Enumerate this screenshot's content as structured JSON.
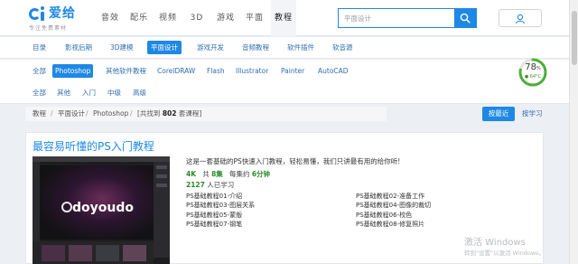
{
  "logo": {
    "text": "爱给",
    "sub": "专注免费素材"
  },
  "topnav": [
    "音效",
    "配乐",
    "视频",
    "3D",
    "游戏",
    "平面",
    "教程"
  ],
  "search": {
    "placeholder": "平面设计",
    "icon": "search-icon"
  },
  "user": {
    "icon": "user-icon"
  },
  "categories": [
    "目录",
    "影视后期",
    "3D建模",
    "平面设计",
    "游戏开发",
    "音频教程",
    "软件插件",
    "软音源"
  ],
  "software": [
    "全部",
    "Photoshop",
    "其他软件教程",
    "CorelDRAW",
    "Flash",
    "Illustrator",
    "Painter",
    "AutoCAD"
  ],
  "levels": [
    "全部",
    "其他",
    "入门",
    "中级",
    "高级"
  ],
  "gauge": {
    "percent": "78",
    "unit": "%",
    "temp": "● 64°C",
    "value": 0.78
  },
  "breadcrumb": {
    "items": [
      "教程",
      "平面设计",
      "Photoshop"
    ],
    "count_pre": "[共找到",
    "count": "802",
    "count_post": "套课程]"
  },
  "sort": {
    "latest": "按最近",
    "popular": "按学习"
  },
  "course": {
    "title": "最容易听懂的PS入门教程",
    "thumb_brand": "doyoudo",
    "description": "这是一套基础的PS快速入门教程，轻松易懂，我们只讲最有用的给你听!",
    "quality": "4K",
    "episodes_pre": "共",
    "episodes": "8集",
    "duration_pre": "每集约",
    "duration": "6分钟",
    "learners": "2127",
    "learners_suffix": "人已学习",
    "lessons": [
      "PS基础教程01-介绍",
      "PS基础教程02-准备工作",
      "PS基础教程03-图层关系",
      "PS基础教程04-图像的裁切",
      "PS基础教程05-蒙版",
      "PS基础教程06-校色",
      "PS基础教程07-钢笔",
      "PS基础教程08-修复照片"
    ]
  },
  "watermark": {
    "line1": "激活 Windows",
    "line2": "转到\"设置\"以激活 Windows。"
  },
  "colors": {
    "accent": "#1e88e5",
    "link": "#2f6fb0",
    "green": "#2a8c2a"
  }
}
